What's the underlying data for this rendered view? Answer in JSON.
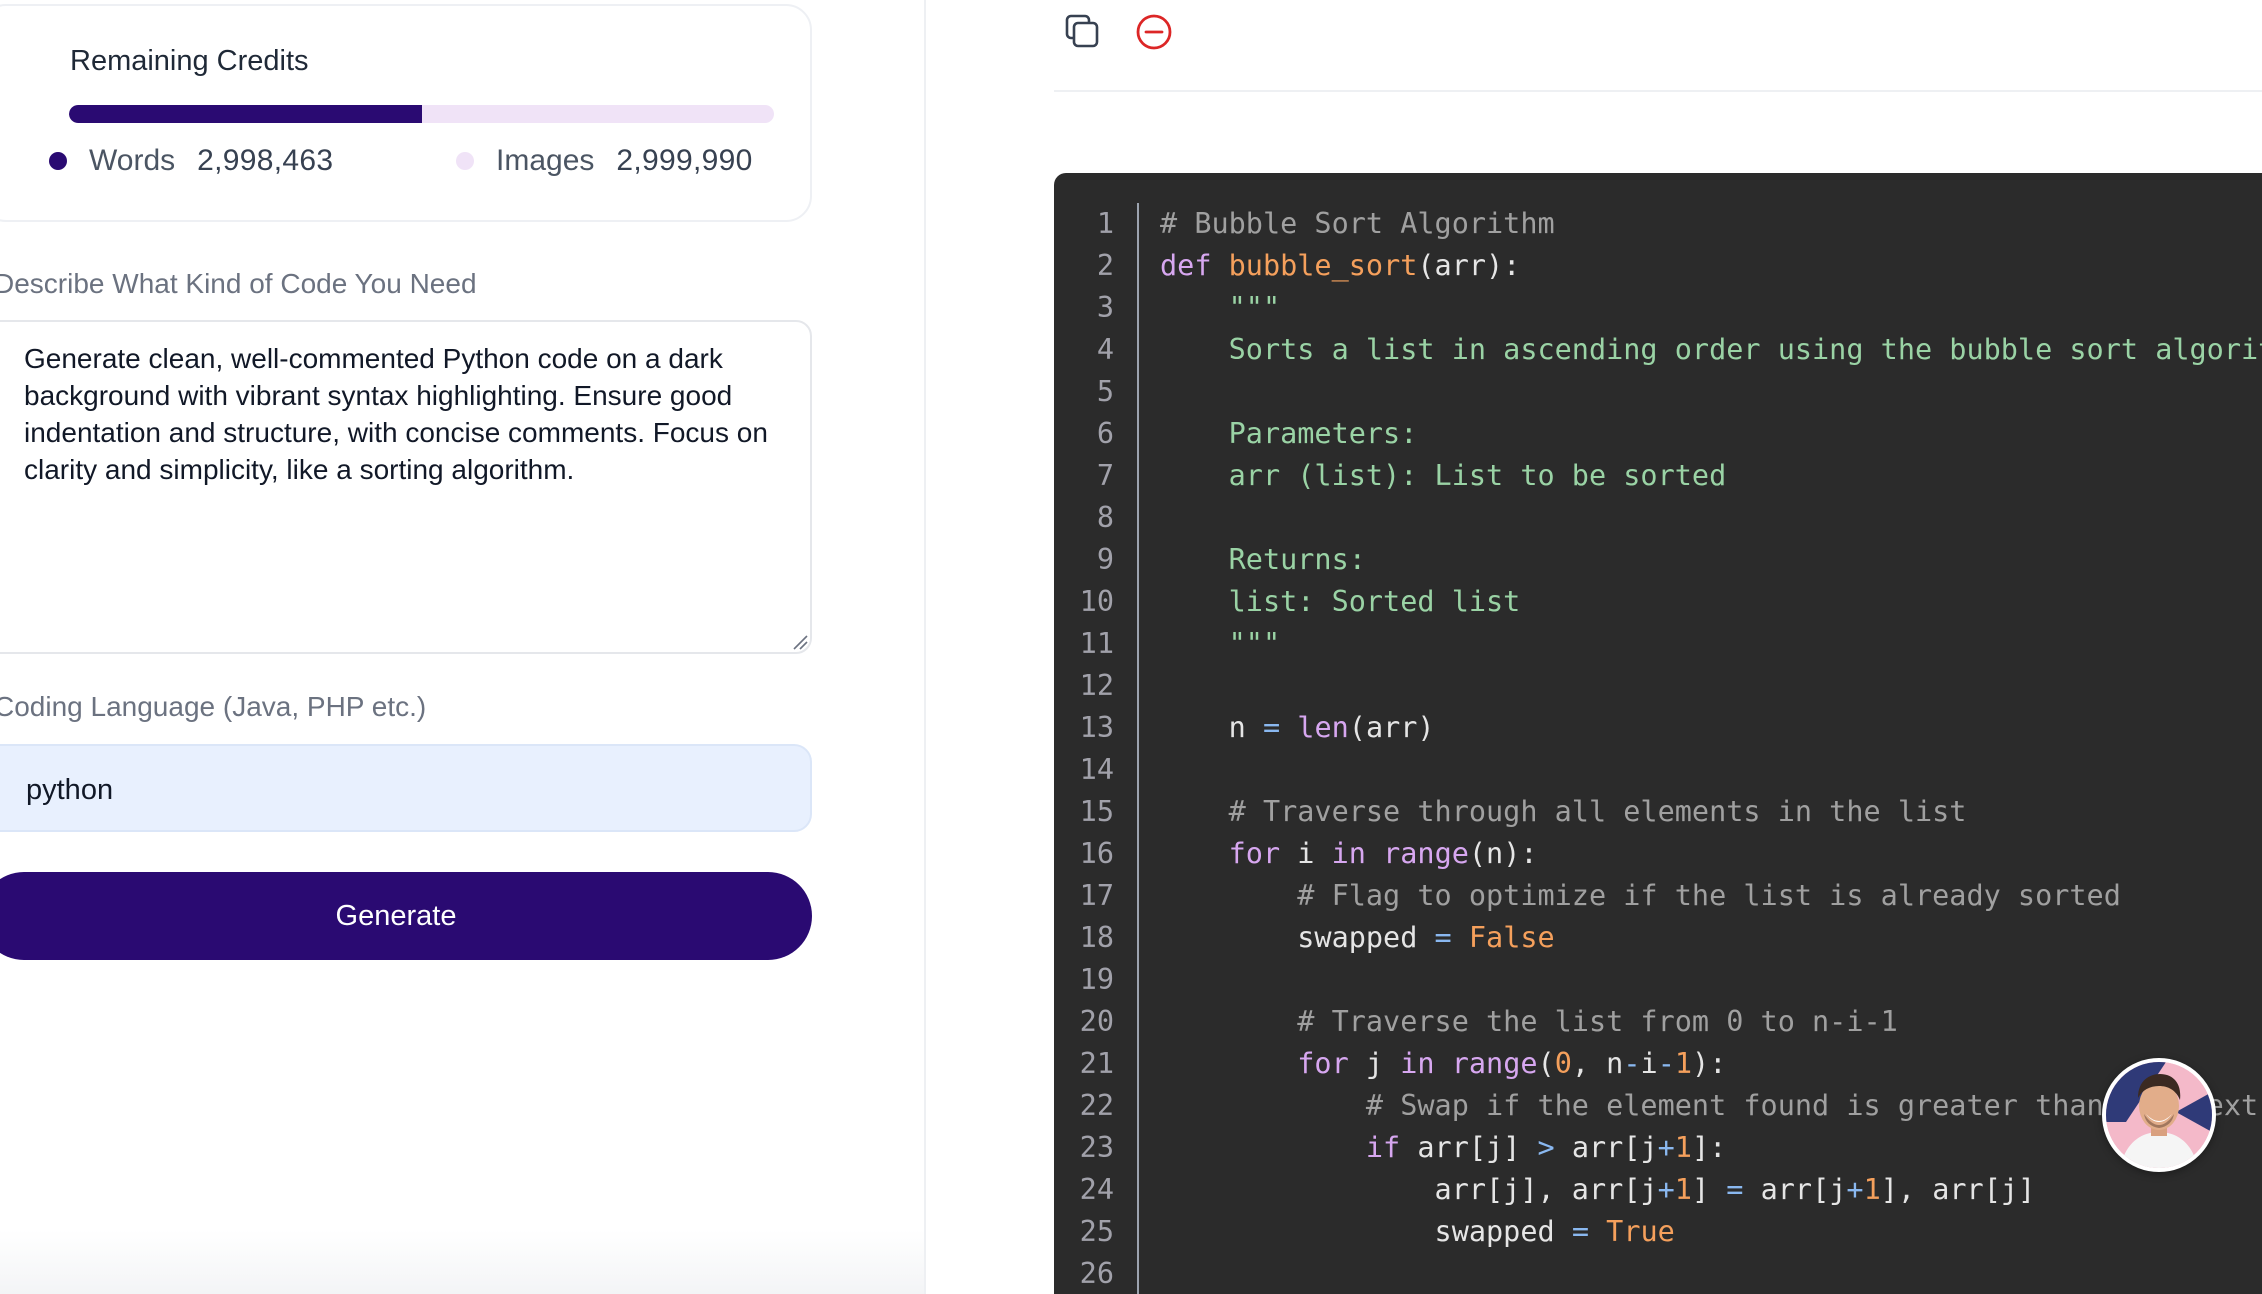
{
  "credits": {
    "title": "Remaining Credits",
    "words_label": "Words",
    "words_value": "2,998,463",
    "images_label": "Images",
    "images_value": "2,999,990",
    "words_fraction": 0.5,
    "colors": {
      "words": "#2a0a72",
      "images": "#f0e3f7"
    }
  },
  "form": {
    "describe_label": "Describe What Kind of Code You Need",
    "describe_value": "Generate clean, well-commented Python code on a dark background with vibrant syntax highlighting. Ensure good indentation and structure, with concise comments. Focus on clarity and simplicity, like a sorting algorithm.",
    "language_label": "Coding Language (Java, PHP etc.)",
    "language_value": "python",
    "generate_label": "Generate"
  },
  "toolbar": {
    "icons": [
      "copy-icon",
      "remove-icon"
    ],
    "accent": "#dc2626"
  },
  "editor": {
    "background": "#2b2b2b",
    "lines": [
      [
        [
          "c-cm",
          "# Bubble Sort Algorithm"
        ]
      ],
      [
        [
          "c-kw",
          "def "
        ],
        [
          "c-fn",
          "bubble_sort"
        ],
        [
          "c-pl",
          "(arr):"
        ]
      ],
      [
        [
          "c-str",
          "    \"\"\""
        ]
      ],
      [
        [
          "c-str",
          "    Sorts a list in ascending order using the bubble sort algorith"
        ]
      ],
      [
        [
          "c-str",
          ""
        ]
      ],
      [
        [
          "c-str",
          "    Parameters:"
        ]
      ],
      [
        [
          "c-str",
          "    arr (list): List to be sorted"
        ]
      ],
      [
        [
          "c-str",
          ""
        ]
      ],
      [
        [
          "c-str",
          "    Returns:"
        ]
      ],
      [
        [
          "c-str",
          "    list: Sorted list"
        ]
      ],
      [
        [
          "c-str",
          "    \"\"\""
        ]
      ],
      [
        [
          "c-pl",
          ""
        ]
      ],
      [
        [
          "c-pl",
          "    n "
        ],
        [
          "c-op",
          "="
        ],
        [
          "c-pl",
          " "
        ],
        [
          "c-bi",
          "len"
        ],
        [
          "c-pl",
          "(arr)"
        ]
      ],
      [
        [
          "c-pl",
          ""
        ]
      ],
      [
        [
          "c-cm",
          "    # Traverse through all elements in the list"
        ]
      ],
      [
        [
          "c-kw",
          "    for "
        ],
        [
          "c-pl",
          "i "
        ],
        [
          "c-kw",
          "in "
        ],
        [
          "c-bi",
          "range"
        ],
        [
          "c-pl",
          "(n):"
        ]
      ],
      [
        [
          "c-cm",
          "        # Flag to optimize if the list is already sorted"
        ]
      ],
      [
        [
          "c-pl",
          "        swapped "
        ],
        [
          "c-op",
          "="
        ],
        [
          "c-pl",
          " "
        ],
        [
          "c-bool",
          "False"
        ]
      ],
      [
        [
          "c-pl",
          ""
        ]
      ],
      [
        [
          "c-cm",
          "        # Traverse the list from 0 to n-i-1"
        ]
      ],
      [
        [
          "c-kw",
          "        for "
        ],
        [
          "c-pl",
          "j "
        ],
        [
          "c-kw",
          "in "
        ],
        [
          "c-bi",
          "range"
        ],
        [
          "c-pl",
          "("
        ],
        [
          "c-num",
          "0"
        ],
        [
          "c-pl",
          ", n"
        ],
        [
          "c-op",
          "-"
        ],
        [
          "c-pl",
          "i"
        ],
        [
          "c-op",
          "-"
        ],
        [
          "c-num",
          "1"
        ],
        [
          "c-pl",
          "):"
        ]
      ],
      [
        [
          "c-cm",
          "            # Swap if the element found is greater than the next e"
        ]
      ],
      [
        [
          "c-kw",
          "            if "
        ],
        [
          "c-pl",
          "arr[j] "
        ],
        [
          "c-op",
          ">"
        ],
        [
          "c-pl",
          " arr[j"
        ],
        [
          "c-op",
          "+"
        ],
        [
          "c-num",
          "1"
        ],
        [
          "c-pl",
          "]:"
        ]
      ],
      [
        [
          "c-pl",
          "                arr[j], arr[j"
        ],
        [
          "c-op",
          "+"
        ],
        [
          "c-num",
          "1"
        ],
        [
          "c-pl",
          "] "
        ],
        [
          "c-op",
          "="
        ],
        [
          "c-pl",
          " arr[j"
        ],
        [
          "c-op",
          "+"
        ],
        [
          "c-num",
          "1"
        ],
        [
          "c-pl",
          "], arr[j]"
        ]
      ],
      [
        [
          "c-pl",
          "                swapped "
        ],
        [
          "c-op",
          "="
        ],
        [
          "c-pl",
          " "
        ],
        [
          "c-bool",
          "True"
        ]
      ],
      [
        [
          "c-pl",
          ""
        ]
      ]
    ]
  }
}
